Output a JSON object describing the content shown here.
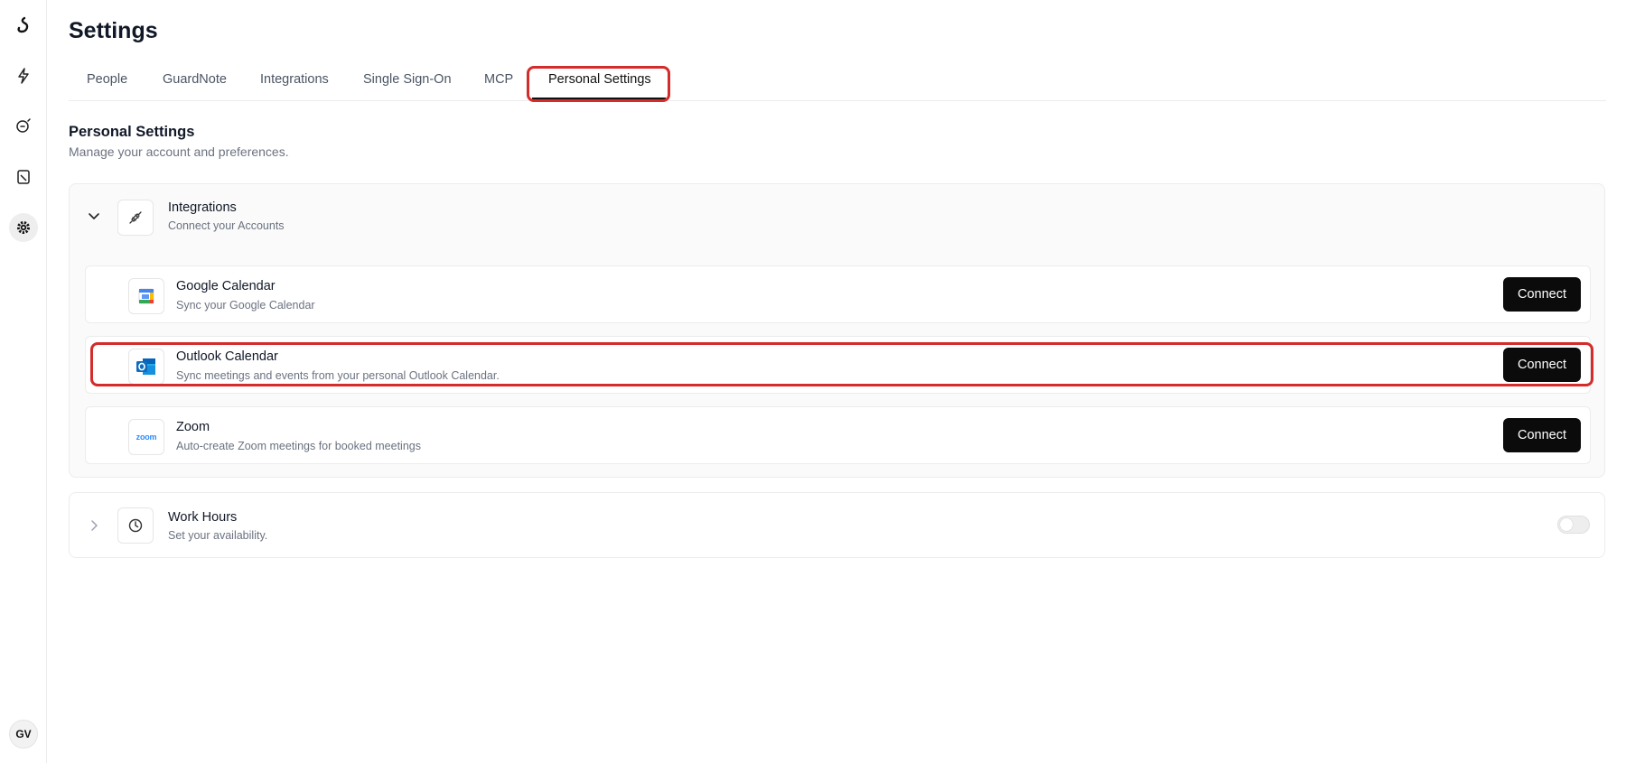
{
  "sidebar": {
    "avatar_initials": "GV",
    "icons": [
      "logo-icon",
      "flash-icon",
      "bot-icon",
      "document-icon",
      "gear-icon"
    ]
  },
  "page": {
    "title": "Settings"
  },
  "tabs": [
    {
      "label": "People"
    },
    {
      "label": "GuardNote"
    },
    {
      "label": "Integrations"
    },
    {
      "label": "Single Sign-On"
    },
    {
      "label": "MCP"
    },
    {
      "label": "Personal Settings",
      "active": true
    }
  ],
  "section": {
    "title": "Personal Settings",
    "subtitle": "Manage your account and preferences."
  },
  "integrations": {
    "title": "Integrations",
    "subtitle": "Connect your Accounts",
    "expanded": true,
    "items": [
      {
        "name": "Google Calendar",
        "description": "Sync your Google Calendar",
        "button": "Connect",
        "icon": "google-calendar-icon"
      },
      {
        "name": "Outlook Calendar",
        "description": "Sync meetings and events from your personal Outlook Calendar.",
        "button": "Connect",
        "icon": "outlook-icon"
      },
      {
        "name": "Zoom",
        "description": "Auto-create Zoom meetings for booked meetings",
        "button": "Connect",
        "icon": "zoom-icon",
        "icon_text": "zoom"
      }
    ]
  },
  "work_hours": {
    "title": "Work Hours",
    "subtitle": "Set your availability.",
    "enabled": false
  },
  "colors": {
    "highlight": "#d42b2b",
    "button": "#0b0b0b",
    "outlook": "#0f6cbd",
    "zoom": "#2d8cff"
  }
}
